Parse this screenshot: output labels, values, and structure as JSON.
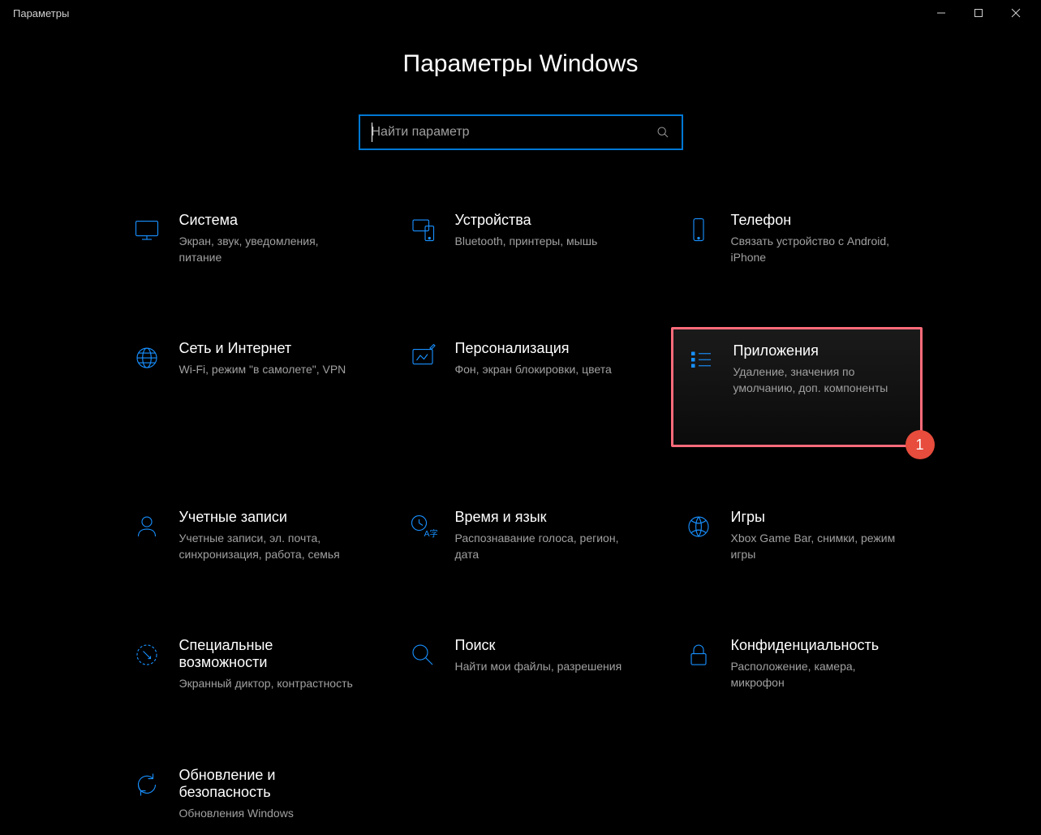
{
  "window": {
    "title": "Параметры"
  },
  "page": {
    "heading": "Параметры Windows"
  },
  "search": {
    "placeholder": "Найти параметр"
  },
  "tiles": [
    {
      "icon": "display",
      "title": "Система",
      "desc": "Экран, звук, уведомления, питание"
    },
    {
      "icon": "devices",
      "title": "Устройства",
      "desc": "Bluetooth, принтеры, мышь"
    },
    {
      "icon": "phone",
      "title": "Телефон",
      "desc": "Связать устройство с Android, iPhone"
    },
    {
      "icon": "globe",
      "title": "Сеть и Интернет",
      "desc": "Wi-Fi, режим \"в самолете\", VPN"
    },
    {
      "icon": "personal",
      "title": "Персонализация",
      "desc": "Фон, экран блокировки, цвета"
    },
    {
      "icon": "apps",
      "title": "Приложения",
      "desc": "Удаление, значения по умолчанию, доп. компоненты",
      "highlighted": true,
      "badge": "1"
    },
    {
      "icon": "account",
      "title": "Учетные записи",
      "desc": "Учетные записи, эл. почта, синхронизация, работа, семья"
    },
    {
      "icon": "time",
      "title": "Время и язык",
      "desc": "Распознавание голоса, регион, дата"
    },
    {
      "icon": "gaming",
      "title": "Игры",
      "desc": "Xbox Game Bar, снимки, режим игры"
    },
    {
      "icon": "access",
      "title": "Специальные возможности",
      "desc": "Экранный диктор, контрастность"
    },
    {
      "icon": "search",
      "title": "Поиск",
      "desc": "Найти мои файлы, разрешения"
    },
    {
      "icon": "privacy",
      "title": "Конфиденциальность",
      "desc": "Расположение, камера, микрофон"
    },
    {
      "icon": "update",
      "title": "Обновление и безопасность",
      "desc": "Обновления Windows"
    }
  ]
}
